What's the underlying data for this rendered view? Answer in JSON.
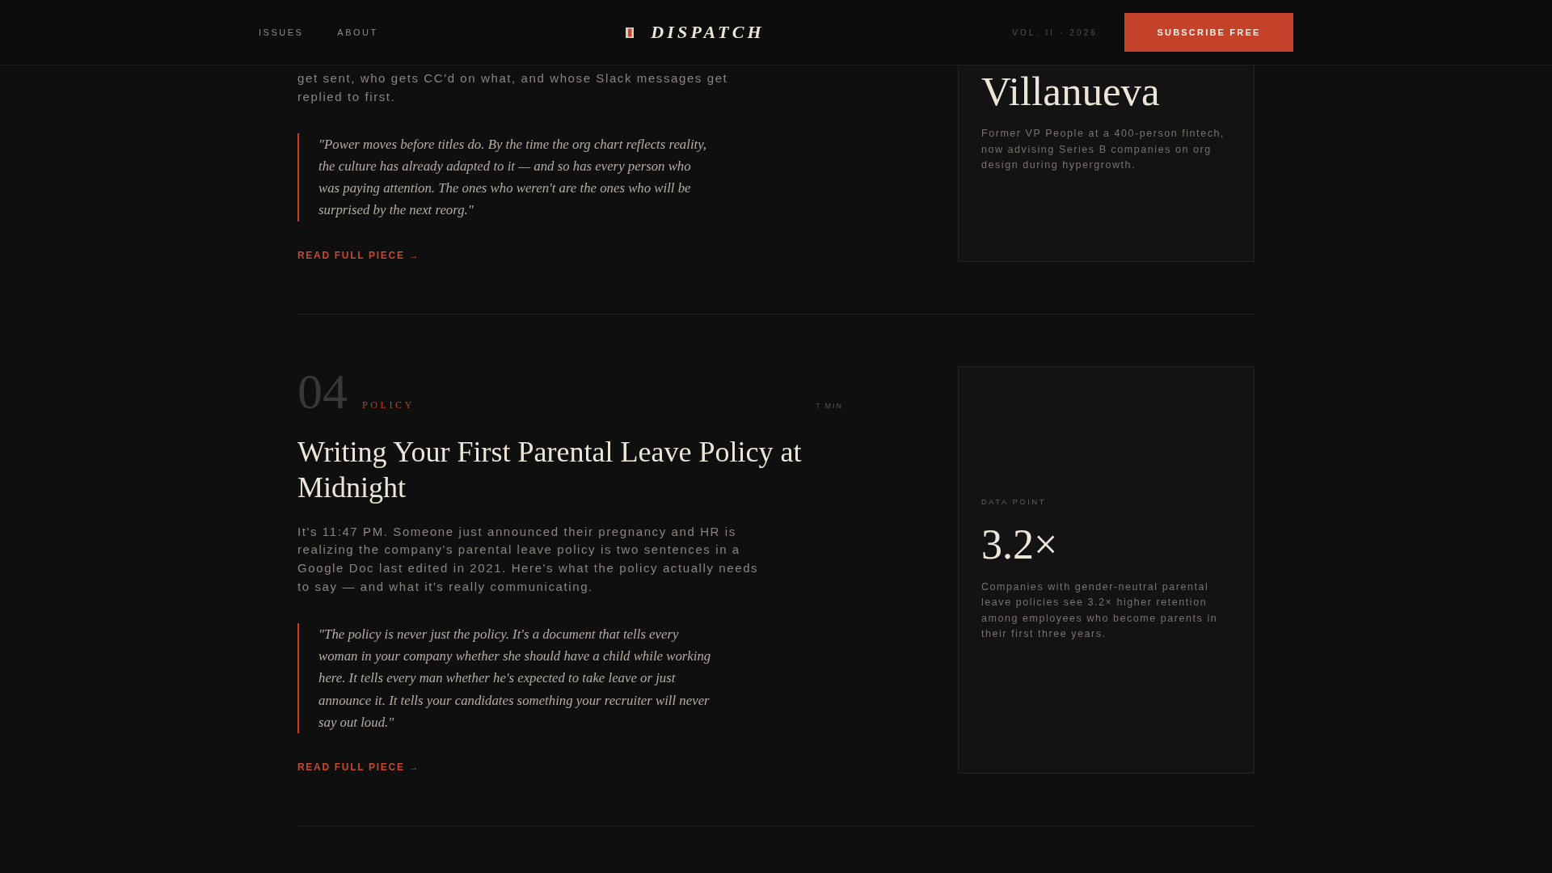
{
  "header": {
    "nav": [
      {
        "label": "ISSUES"
      },
      {
        "label": "ABOUT"
      }
    ],
    "logo": "DISPATCH",
    "volume": "VOL. II · 2026",
    "subscribe": "SUBSCRIBE FREE"
  },
  "articles": [
    {
      "excerpt": "get sent, who gets CC'd on what, and whose Slack messages get replied to first.",
      "quote": "\"Power moves before titles do. By the time the org chart reflects reality, the culture has already adapted to it — and so has every person who was paying attention. The ones who weren't are the ones who will be surprised by the next reorg.\"",
      "link": "READ FULL PIECE →",
      "aside": {
        "kind": "profile",
        "name": "Villanueva",
        "bio": "Former VP People at a 400-person fintech, now advising Series B companies on org design during hypergrowth."
      }
    },
    {
      "number": "04",
      "category": "POLICY",
      "read_time": "7 MIN",
      "title": "Writing Your First Parental Leave Policy at Midnight",
      "excerpt": "It's 11:47 PM. Someone just announced their pregnancy and HR is realizing the company's parental leave policy is two sentences in a Google Doc last edited in 2021. Here's what the policy actually needs to say — and what it's really communicating.",
      "quote": "\"The policy is never just the policy. It's a document that tells every woman in your company whether she should have a child while working here. It tells every man whether he's expected to take leave or just announce it. It tells your candidates something your recruiter will never say out loud.\"",
      "link": "READ FULL PIECE →",
      "aside": {
        "kind": "stat",
        "label": "DATA POINT",
        "value": "3.2×",
        "text": "Companies with gender-neutral parental leave policies see 3.2× higher retention among employees who become parents in their first three years."
      }
    }
  ]
}
